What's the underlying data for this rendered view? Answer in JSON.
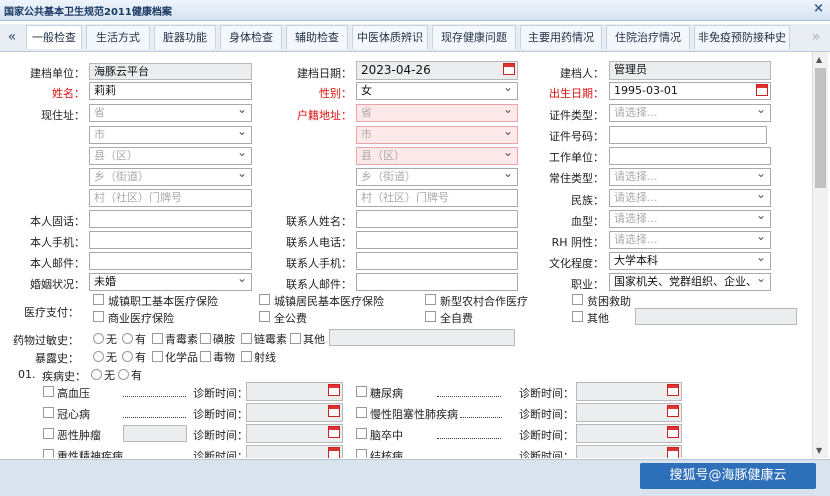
{
  "window": {
    "title": "国家公共基本卫生规范2011健康档案",
    "close": "×"
  },
  "tabs": [
    {
      "label": "一般检查"
    },
    {
      "label": "生活方式"
    },
    {
      "label": "脏器功能"
    },
    {
      "label": "身体检查"
    },
    {
      "label": "辅助检查"
    },
    {
      "label": "中医体质辨识"
    },
    {
      "label": "现存健康问题"
    },
    {
      "label": "主要用药情况"
    },
    {
      "label": "住院治疗情况"
    },
    {
      "label": "非免疫预防接种史"
    }
  ],
  "nav": {
    "prev": "«",
    "next": "»"
  },
  "form": {
    "l_unit": "建档单位：",
    "v_unit": "海豚云平台",
    "l_date": "建档日期：",
    "v_date": "2023-04-26",
    "l_creator": "建档人：",
    "v_creator": "管理员",
    "l_name": "姓名：",
    "v_name": "莉莉",
    "l_gender": "性别：",
    "v_gender": "女",
    "l_birth": "出生日期：",
    "v_birth": "1995-03-01",
    "l_addr": "现住址：",
    "l_huji": "户籍地址：",
    "ph_prov": "省",
    "ph_city": "市",
    "ph_county": "县（区）",
    "ph_town": "乡（街道）",
    "ph_village": "村（社区）门牌号",
    "l_idtype": "证件类型：",
    "l_idno": "证件号码：",
    "l_work": "工作单位：",
    "l_restype": "常住类型：",
    "l_nation": "民族：",
    "l_blood": "血型：",
    "l_rh": "RH 阴性：",
    "l_edu": "文化程度：",
    "l_job": "职业：",
    "ph_choose": "请选择...",
    "v_edu": "大学本科",
    "v_job": "国家机关、党群组织、企业、",
    "l_phone": "本人固话：",
    "l_mobile": "本人手机：",
    "l_email": "本人邮件：",
    "l_marital": "婚姻状况：",
    "v_marital": "未婚",
    "l_cname": "联系人姓名：",
    "l_cphone": "联系人电话：",
    "l_cmobile": "联系人手机：",
    "l_cemail": "联系人邮件：",
    "l_payment": "医疗支付：",
    "pay": [
      "城镇职工基本医疗保险",
      "城镇居民基本医疗保险",
      "新型农村合作医疗",
      "贫困救助",
      "商业医疗保险",
      "全公费",
      "全自费",
      "其他"
    ],
    "l_allergy": "药物过敏史：",
    "l_exposure": "暴露史：",
    "o_none": "无",
    "o_have": "有",
    "allergy": [
      "青霉素",
      "磺胺",
      "链霉素",
      "其他"
    ],
    "exposure": [
      "化学品",
      "毒物",
      "射线"
    ],
    "n01": "01.",
    "l_disease": "疾病史：",
    "diseases": [
      "高血压",
      "冠心病",
      "恶性肿瘤",
      "重性精神疾病",
      "糖尿病",
      "慢性阻塞性肺疾病",
      "脑卒中",
      "结核病"
    ],
    "l_diag": "诊断时间："
  },
  "footer": {
    "save": "搜狐号@海豚健康云"
  }
}
